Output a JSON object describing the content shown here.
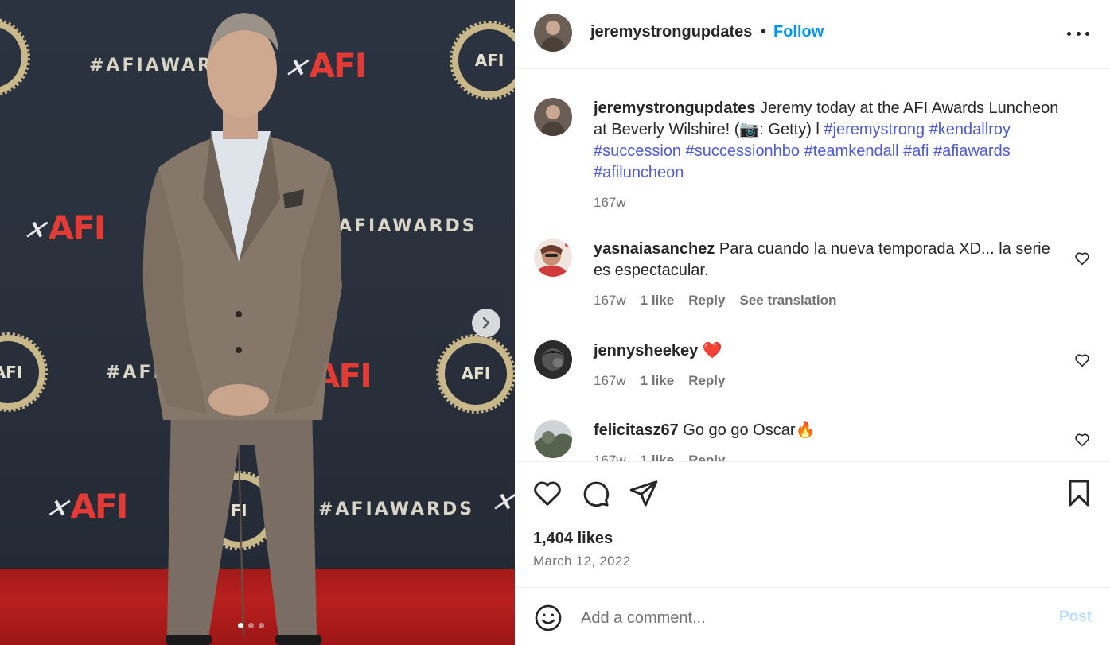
{
  "post": {
    "username": "jeremystrongupdates",
    "separator": "•",
    "follow_label": "Follow",
    "carousel": {
      "slides": 3,
      "current": 1
    },
    "caption": {
      "username": "jeremystrongupdates",
      "text_1": "Jeremy today at the AFI Awards Luncheon at Beverly Wilshire! (",
      "camera_emoji": "📷",
      "text_2": ": Getty) l ",
      "hashtags": [
        "#jeremystrong",
        "#kendallroy",
        "#succession",
        "#successionhbo",
        "#teamkendall",
        "#afi",
        "#afiawards",
        "#afiluncheon"
      ],
      "time": "167w"
    },
    "comments": [
      {
        "username": "yasnaiasanchez",
        "text": "Para cuando la nueva temporada XD... la serie es espectacular.",
        "time": "167w",
        "likes": "1 like",
        "reply": "Reply",
        "translate": "See translation"
      },
      {
        "username": "jennysheekey",
        "text": "❤️",
        "time": "167w",
        "likes": "1 like",
        "reply": "Reply"
      },
      {
        "username": "felicitasz67",
        "text": "Go go go Oscar🔥",
        "time": "167w",
        "likes": "1 like",
        "reply": "Reply"
      }
    ],
    "likes_count": "1,404 likes",
    "date": "March 12, 2022",
    "add_comment": {
      "placeholder": "Add a comment...",
      "post_label": "Post"
    }
  },
  "backdrop": {
    "hashtag_text": "#AFIAWARDS",
    "hashtag_text_short": "#AFIAWAR",
    "hashtag_text_short2": "#AFIA",
    "hashtag_text_tail": "AFIAWARDS",
    "logo": "AFI",
    "logo_short": "FI"
  },
  "colors": {
    "link": "#0095f6",
    "hashtag": "#4f5bd5",
    "meta": "#737373",
    "post_disabled": "#b9dffc"
  }
}
